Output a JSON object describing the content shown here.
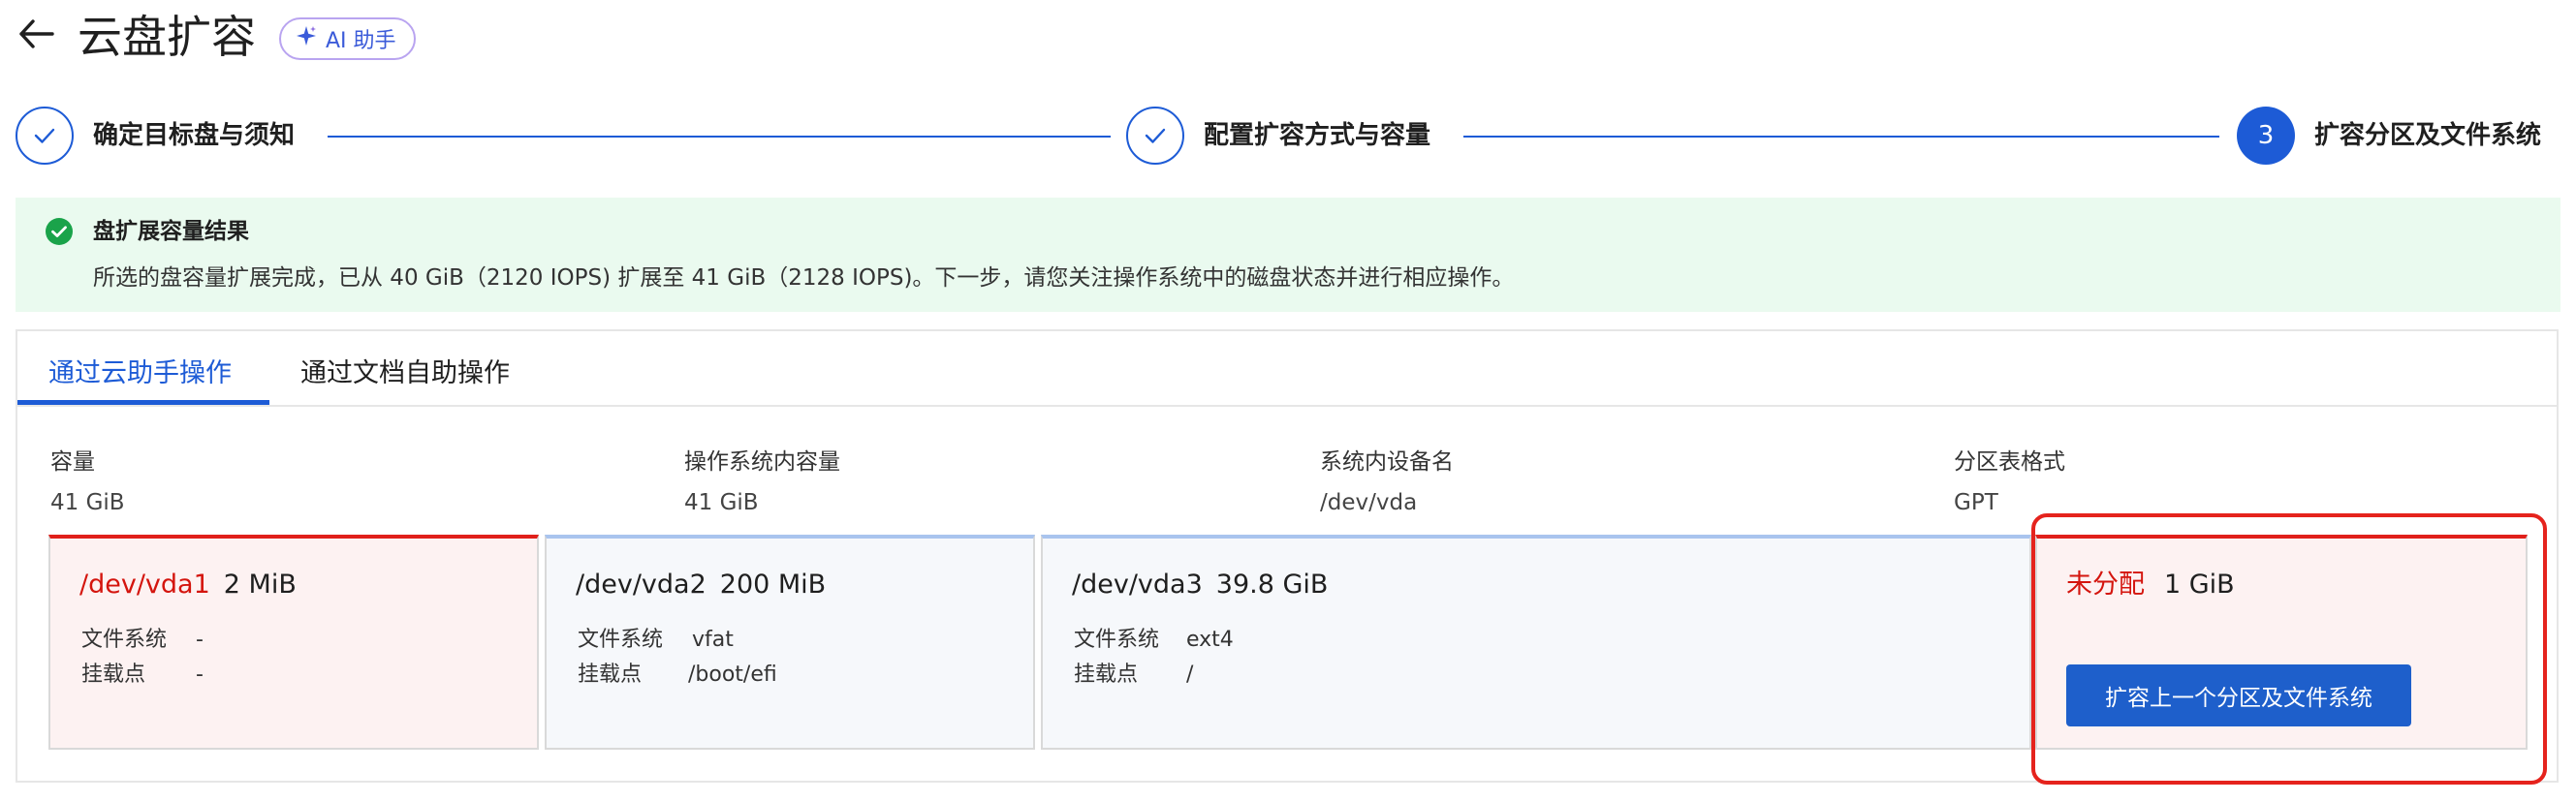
{
  "header": {
    "title": "云盘扩容",
    "ai_button_label": "AI 助手"
  },
  "steps": [
    {
      "label": "确定目标盘与须知",
      "state": "done"
    },
    {
      "label": "配置扩容方式与容量",
      "state": "done"
    },
    {
      "number": "3",
      "label": "扩容分区及文件系统",
      "state": "active"
    }
  ],
  "result_banner": {
    "title": "盘扩展容量结果",
    "description": "所选的盘容量扩展完成，已从 40 GiB（2120 IOPS) 扩展至 41 GiB（2128 IOPS)。下一步，请您关注操作系统中的磁盘状态并进行相应操作。"
  },
  "tabs": [
    {
      "label": "通过云助手操作",
      "active": true
    },
    {
      "label": "通过文档自助操作",
      "active": false
    }
  ],
  "disk_info": [
    {
      "label": "容量",
      "value": "41 GiB"
    },
    {
      "label": "操作系统内容量",
      "value": "41 GiB"
    },
    {
      "label": "系统内设备名",
      "value": "/dev/vda"
    },
    {
      "label": "分区表格式",
      "value": "GPT"
    }
  ],
  "partitions": [
    {
      "name": "/dev/vda1",
      "size": "2 MiB",
      "fs_label": "文件系统",
      "fs_value": "-",
      "mount_label": "挂载点",
      "mount_value": "-"
    },
    {
      "name": "/dev/vda2",
      "size": "200 MiB",
      "fs_label": "文件系统",
      "fs_value": "vfat",
      "mount_label": "挂载点",
      "mount_value": "/boot/efi"
    },
    {
      "name": "/dev/vda3",
      "size": "39.8 GiB",
      "fs_label": "文件系统",
      "fs_value": "ext4",
      "mount_label": "挂载点",
      "mount_value": "/"
    }
  ],
  "unallocated": {
    "label": "未分配",
    "size": "1 GiB",
    "button_label": "扩容上一个分区及文件系统"
  },
  "colors": {
    "primary": "#1d5bd6",
    "success_bg": "#eafaef",
    "success_icon": "#1aa34a",
    "danger": "#e0201a"
  }
}
